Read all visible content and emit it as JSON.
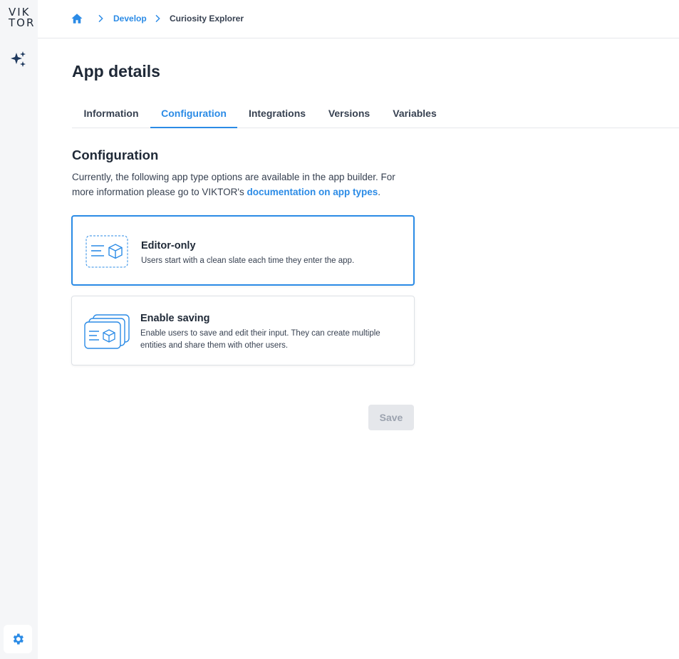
{
  "brand": {
    "logo_line1": "VIK",
    "logo_line2": "TOR",
    "accent": "#2b8be6"
  },
  "sidebar": {
    "top_icon": "sparkle-icon",
    "bottom_icon": "gear-icon"
  },
  "breadcrumb": {
    "home_icon": "home-icon",
    "items": [
      "Develop",
      "Curiosity Explorer"
    ]
  },
  "page": {
    "title": "App details"
  },
  "tabs": [
    {
      "label": "Information",
      "active": false
    },
    {
      "label": "Configuration",
      "active": true
    },
    {
      "label": "Integrations",
      "active": false
    },
    {
      "label": "Versions",
      "active": false
    },
    {
      "label": "Variables",
      "active": false
    }
  ],
  "configuration": {
    "title": "Configuration",
    "description_prefix": "Currently, the following app type options are available in the app builder. For more information please go to VIKTOR's ",
    "link_text": "documentation on app types",
    "description_suffix": ".",
    "options": [
      {
        "title": "Editor-only",
        "description": "Users start with a clean slate each time they enter the app.",
        "selected": true,
        "icon": "editor-only-icon"
      },
      {
        "title": "Enable saving",
        "description": "Enable users to save and edit their input. They can create multiple entities and share them with other users.",
        "selected": false,
        "icon": "enable-saving-icon"
      }
    ],
    "save_label": "Save"
  }
}
